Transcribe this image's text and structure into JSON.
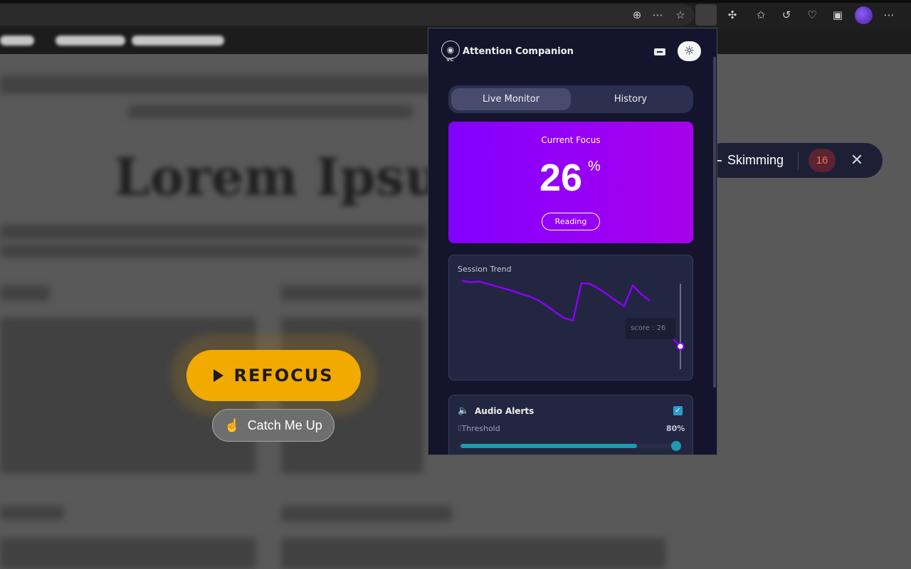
{
  "popup": {
    "app_title": "Attention Companion",
    "logo_text": "VC",
    "tabs": [
      {
        "label": "Live Monitor",
        "active": true
      },
      {
        "label": "History",
        "active": false
      }
    ],
    "focus": {
      "label": "Current Focus",
      "value": "26",
      "unit": "%",
      "state": "Reading"
    },
    "trend": {
      "label": "Session Trend",
      "tooltip": "score : 26"
    },
    "audio": {
      "title": "Audio Alerts",
      "enabled": true,
      "threshold_label": "Threshold",
      "threshold_value": "80%",
      "threshold": 0.8
    }
  },
  "overlay": {
    "skimming_label": "Skimming",
    "skimming_count": "16",
    "refocus_label": "REFOCUS",
    "catch_up_label": "Catch Me Up"
  },
  "colors": {
    "accent": "#8a00ff",
    "refocus": "#f2a900",
    "badge_text": "#ff6a6a",
    "slider": "#1f9bb0"
  },
  "chart_data": {
    "type": "line",
    "y": [
      95,
      93,
      94,
      91,
      88,
      85,
      82,
      78,
      75,
      70,
      63,
      55,
      48,
      45,
      92,
      91,
      85,
      78,
      70,
      63,
      89,
      78,
      70
    ],
    "current": 26,
    "ylim": [
      0,
      100
    ]
  },
  "toolbar_icons": [
    "zoom-icon",
    "more-icon",
    "favorite-star-icon",
    "extension-active-icon",
    "extensions-icon",
    "favorites-icon",
    "history-icon",
    "health-icon",
    "screenshot-icon",
    "profile-avatar",
    "menu-icon"
  ]
}
